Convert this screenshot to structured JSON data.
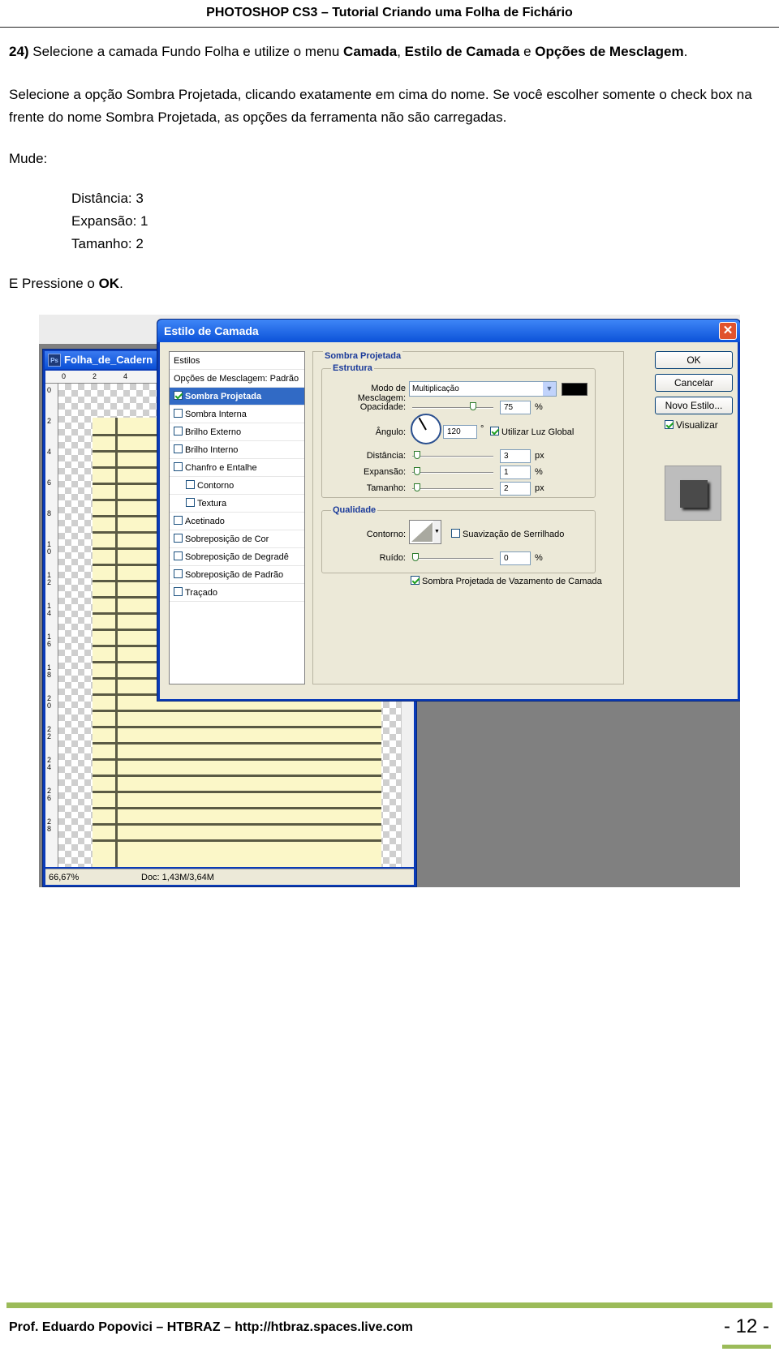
{
  "header": {
    "title": "PHOTOSHOP CS3 – Tutorial Criando uma Folha de Fichário"
  },
  "step": {
    "number": "24)",
    "intro_1": " Selecione a camada Fundo Folha e utilize o menu ",
    "menu_1": "Camada",
    "sep_1": ", ",
    "menu_2": "Estilo de Camada",
    "sep_2": " e ",
    "menu_3": "Opções de Mesclagem",
    "end": ".",
    "paragraph_2": "Selecione a opção Sombra Projetada, clicando exatamente em cima do nome. Se você escolher somente o check box na frente do nome Sombra Projetada, as opções da ferramenta não são carregadas.",
    "change_label": "Mude:",
    "values": [
      "Distância: 3",
      "Expansão: 1",
      "Tamanho: 2"
    ],
    "press_prefix": "E Pressione o ",
    "press_key": "OK",
    "press_end": "."
  },
  "screenshot": {
    "doc_window": {
      "title": "Folha_de_Cadern",
      "ps_icon": "Ps",
      "zoom": "66,67%",
      "doc_size": "Doc: 1,43M/3,64M",
      "ruler_top": [
        "0",
        "2",
        "4"
      ],
      "ruler_left": [
        "0",
        "2",
        "4",
        "6",
        "8",
        "1 0",
        "1 2",
        "1 4",
        "1 6",
        "1 8",
        "2 0",
        "2 2",
        "2 4",
        "2 6",
        "2 8"
      ]
    },
    "dialog": {
      "title": "Estilo de Camada",
      "close": "✕",
      "styles_list": [
        {
          "label": "Estilos",
          "checkbox": false,
          "checked": false,
          "sub": false,
          "selected": false
        },
        {
          "label": "Opções de Mesclagem: Padrão",
          "checkbox": false,
          "checked": false,
          "sub": false,
          "selected": false
        },
        {
          "label": "Sombra Projetada",
          "checkbox": true,
          "checked": true,
          "sub": false,
          "selected": true
        },
        {
          "label": "Sombra Interna",
          "checkbox": true,
          "checked": false,
          "sub": false,
          "selected": false
        },
        {
          "label": "Brilho Externo",
          "checkbox": true,
          "checked": false,
          "sub": false,
          "selected": false
        },
        {
          "label": "Brilho Interno",
          "checkbox": true,
          "checked": false,
          "sub": false,
          "selected": false
        },
        {
          "label": "Chanfro e Entalhe",
          "checkbox": true,
          "checked": false,
          "sub": false,
          "selected": false
        },
        {
          "label": "Contorno",
          "checkbox": true,
          "checked": false,
          "sub": true,
          "selected": false
        },
        {
          "label": "Textura",
          "checkbox": true,
          "checked": false,
          "sub": true,
          "selected": false
        },
        {
          "label": "Acetinado",
          "checkbox": true,
          "checked": false,
          "sub": false,
          "selected": false
        },
        {
          "label": "Sobreposição de Cor",
          "checkbox": true,
          "checked": false,
          "sub": false,
          "selected": false
        },
        {
          "label": "Sobreposição de Degradê",
          "checkbox": true,
          "checked": false,
          "sub": false,
          "selected": false
        },
        {
          "label": "Sobreposição de Padrão",
          "checkbox": true,
          "checked": false,
          "sub": false,
          "selected": false
        },
        {
          "label": "Traçado",
          "checkbox": true,
          "checked": false,
          "sub": false,
          "selected": false
        }
      ],
      "section_title": "Sombra Projetada",
      "structure_title": "Estrutura",
      "blend_mode_label": "Modo de Mesclagem:",
      "blend_mode_value": "Multiplicação",
      "shadow_color": "#000000",
      "opacity_label": "Opacidade:",
      "opacity_value": "75",
      "opacity_level": 0.75,
      "angle_label": "Ângulo:",
      "angle_value": "120",
      "degree_sign": "°",
      "global_light_label": "Utilizar Luz Global",
      "distance_label": "Distância:",
      "distance_value": "3",
      "spread_label": "Expansão:",
      "spread_value": "1",
      "size_label": "Tamanho:",
      "size_value": "2",
      "unit_percent": "%",
      "unit_px": "px",
      "quality_title": "Qualidade",
      "contour_label": "Contorno:",
      "antialias_label": "Suavização de Serrilhado",
      "noise_label": "Ruído:",
      "noise_value": "0",
      "knockout_label": "Sombra Projetada de Vazamento de Camada",
      "ok_label": "OK",
      "cancel_label": "Cancelar",
      "new_style_label": "Novo Estilo...",
      "preview_label": "Visualizar"
    }
  },
  "footer": {
    "text": "Prof. Eduardo Popovici – HTBRAZ – http://htbraz.spaces.live.com",
    "page": "- 12 -",
    "accent_color": "#9bbb59"
  }
}
